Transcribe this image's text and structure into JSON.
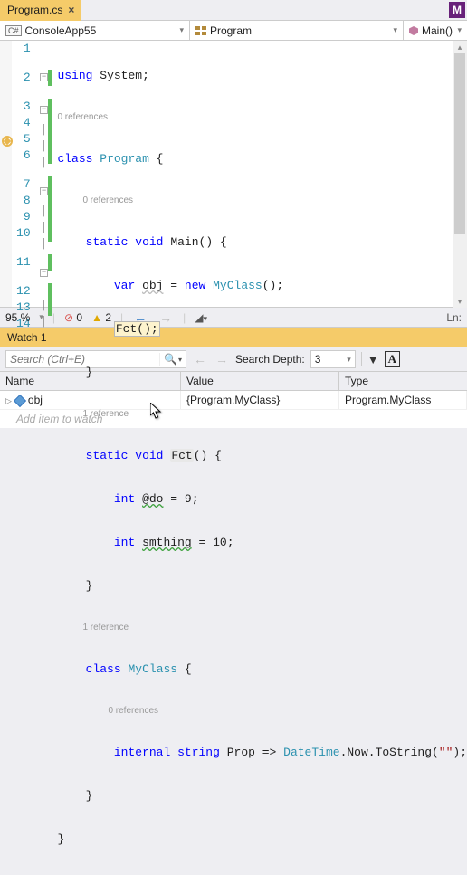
{
  "tab": {
    "title": "Program.cs",
    "hint": "M"
  },
  "nav": {
    "project": "ConsoleApp55",
    "class": "Program",
    "member": "Main()"
  },
  "code": {
    "lines": [
      1,
      2,
      3,
      4,
      5,
      6,
      7,
      8,
      9,
      10,
      11,
      12,
      13,
      14
    ],
    "l1_using": "using",
    "l1_ns": "System",
    "l1_semi": ";",
    "ref0": "0 references",
    "l2_class": "class",
    "l2_name": "Program",
    "l2_ob": " {",
    "l3_static": "static",
    "l3_void": "void",
    "l3_name": "Main",
    "l3_rest": "() {",
    "l4_var": "var",
    "l4_obj": "obj",
    "l4_eq": " = ",
    "l4_new": "new",
    "l4_type": "MyClass",
    "l4_rest": "();",
    "l5_call": "Fct()",
    "l5_semi": ";",
    "l6_cb": "}",
    "ref1": "1 reference",
    "l7_static": "static",
    "l7_void": "void",
    "l7_name": "Fct",
    "l7_rest": "() {",
    "l8_int": "int",
    "l8_name": "@do",
    "l8_rest": " = 9;",
    "l9_int": "int",
    "l9_name": "smthing",
    "l9_rest": " = 10;",
    "l10_cb": "}",
    "l11_class": "class",
    "l11_name": "MyClass",
    "l11_ob": " {",
    "l12_internal": "internal",
    "l12_string": "string",
    "l12_prop": "Prop",
    "l12_arrow": " => ",
    "l12_dt": "DateTime",
    "l12_now": ".Now.ToString(",
    "l12_str": "\"\"",
    "l12_end": ");",
    "l13_cb": "}",
    "l14_cb": "}"
  },
  "status": {
    "zoom": "95 %",
    "errors": "0",
    "warnings": "2",
    "ln_label": "Ln:"
  },
  "watch": {
    "title": "Watch 1",
    "search_placeholder": "Search (Ctrl+E)",
    "depth_label": "Search Depth:",
    "depth_value": "3",
    "cols": {
      "name": "Name",
      "value": "Value",
      "type": "Type"
    },
    "row": {
      "name": "obj",
      "value": "{Program.MyClass}",
      "type": "Program.MyClass"
    },
    "add": "Add item to watch"
  }
}
